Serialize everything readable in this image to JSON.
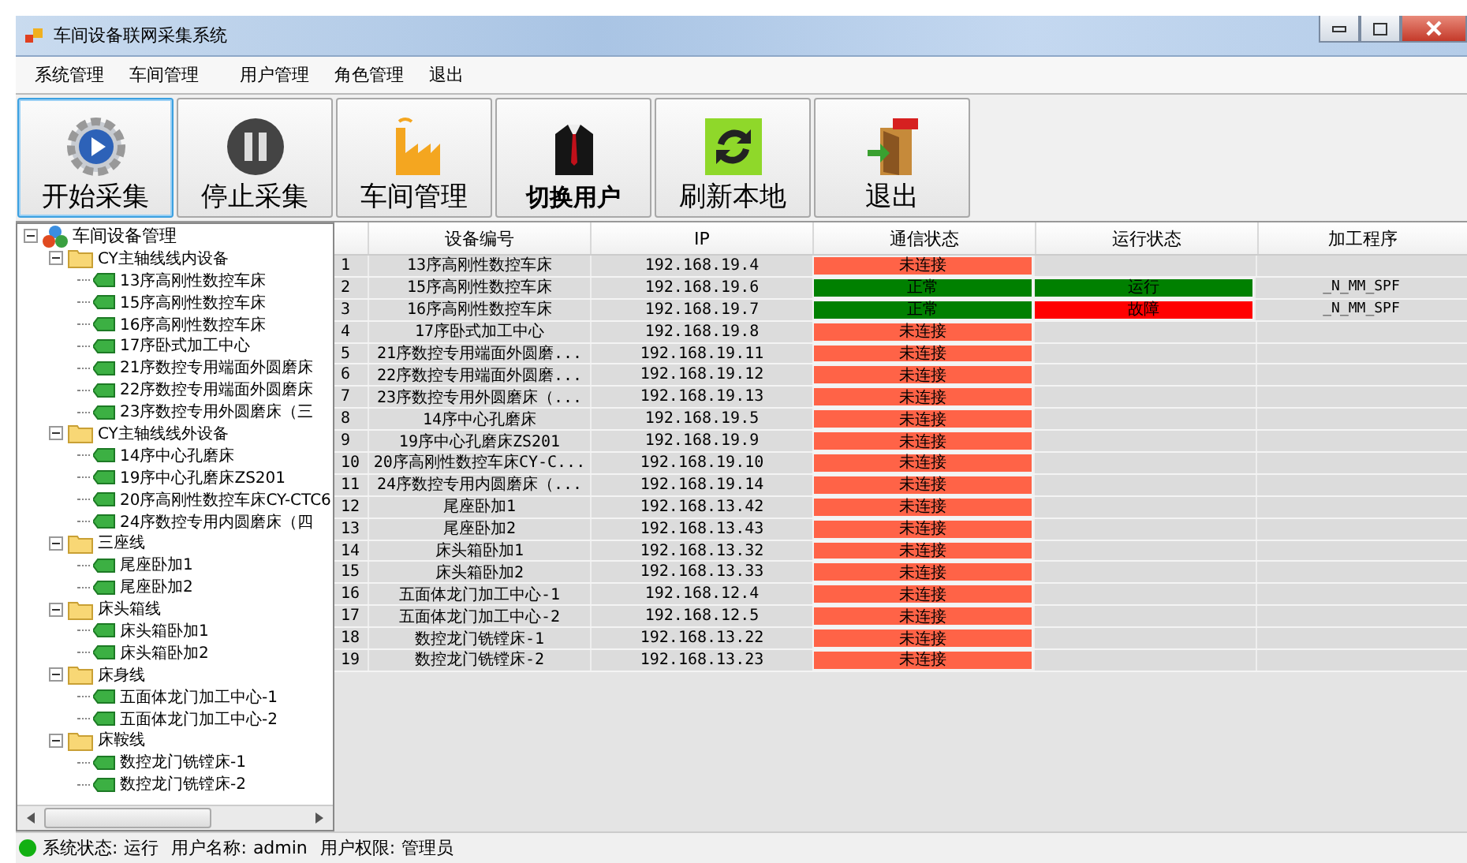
{
  "window": {
    "title": "车间设备联网采集系统"
  },
  "menu": [
    "系统管理",
    "车间管理",
    "用户管理",
    "角色管理",
    "退出"
  ],
  "toolbar": [
    {
      "label": "开始采集",
      "kind": "start",
      "selected": true
    },
    {
      "label": "停止采集",
      "kind": "stop",
      "selected": false
    },
    {
      "label": "车间管理",
      "kind": "factory",
      "selected": false
    },
    {
      "label": "切换用户",
      "kind": "user",
      "selected": false
    },
    {
      "label": "刷新本地",
      "kind": "refresh",
      "selected": false
    },
    {
      "label": "退出",
      "kind": "exit",
      "selected": false
    }
  ],
  "tree": [
    {
      "label": "车间设备管理",
      "kind": "root",
      "expanded": true,
      "children": [
        {
          "label": "CY主轴线线内设备",
          "kind": "folder",
          "expanded": true,
          "children": [
            {
              "label": "13序高刚性数控车床",
              "kind": "device"
            },
            {
              "label": "15序高刚性数控车床",
              "kind": "device"
            },
            {
              "label": "16序高刚性数控车床",
              "kind": "device"
            },
            {
              "label": "17序卧式加工中心",
              "kind": "device"
            },
            {
              "label": "21序数控专用端面外圆磨床",
              "kind": "device"
            },
            {
              "label": "22序数控专用端面外圆磨床",
              "kind": "device"
            },
            {
              "label": "23序数控专用外圆磨床（三",
              "kind": "device"
            }
          ]
        },
        {
          "label": "CY主轴线线外设备",
          "kind": "folder",
          "expanded": true,
          "children": [
            {
              "label": "14序中心孔磨床",
              "kind": "device"
            },
            {
              "label": "19序中心孔磨床ZS201",
              "kind": "device"
            },
            {
              "label": "20序高刚性数控车床CY-CTC6",
              "kind": "device"
            },
            {
              "label": "24序数控专用内圆磨床（四",
              "kind": "device"
            }
          ]
        },
        {
          "label": "三座线",
          "kind": "folder",
          "expanded": true,
          "children": [
            {
              "label": "尾座卧加1",
              "kind": "device"
            },
            {
              "label": "尾座卧加2",
              "kind": "device"
            }
          ]
        },
        {
          "label": "床头箱线",
          "kind": "folder",
          "expanded": true,
          "children": [
            {
              "label": "床头箱卧加1",
              "kind": "device"
            },
            {
              "label": "床头箱卧加2",
              "kind": "device"
            }
          ]
        },
        {
          "label": "床身线",
          "kind": "folder",
          "expanded": true,
          "children": [
            {
              "label": "五面体龙门加工中心-1",
              "kind": "device"
            },
            {
              "label": "五面体龙门加工中心-2",
              "kind": "device"
            }
          ]
        },
        {
          "label": "床鞍线",
          "kind": "folder",
          "expanded": true,
          "children": [
            {
              "label": "数控龙门铣镗床-1",
              "kind": "device"
            },
            {
              "label": "数控龙门铣镗床-2",
              "kind": "device"
            }
          ]
        }
      ]
    }
  ],
  "table": {
    "columns": [
      "设备编号",
      "IP",
      "通信状态",
      "运行状态",
      "加工程序"
    ],
    "rows": [
      {
        "no": "1",
        "device": "13序高刚性数控车床",
        "ip": "192.168.19.4",
        "comm": {
          "text": "未连接",
          "color": "#ff6347"
        }
      },
      {
        "no": "2",
        "device": "15序高刚性数控车床",
        "ip": "192.168.19.6",
        "comm": {
          "text": "正常",
          "color": "#008000"
        },
        "run": {
          "text": "运行",
          "color": "#008000"
        },
        "program": "_N_MM_SPF"
      },
      {
        "no": "3",
        "device": "16序高刚性数控车床",
        "ip": "192.168.19.7",
        "comm": {
          "text": "正常",
          "color": "#008000"
        },
        "run": {
          "text": "故障",
          "color": "#ff0000"
        },
        "program": "_N_MM_SPF"
      },
      {
        "no": "4",
        "device": "17序卧式加工中心",
        "ip": "192.168.19.8",
        "comm": {
          "text": "未连接",
          "color": "#ff6347"
        }
      },
      {
        "no": "5",
        "device": "21序数控专用端面外圆磨...",
        "ip": "192.168.19.11",
        "comm": {
          "text": "未连接",
          "color": "#ff6347"
        }
      },
      {
        "no": "6",
        "device": "22序数控专用端面外圆磨...",
        "ip": "192.168.19.12",
        "comm": {
          "text": "未连接",
          "color": "#ff6347"
        }
      },
      {
        "no": "7",
        "device": "23序数控专用外圆磨床（...",
        "ip": "192.168.19.13",
        "comm": {
          "text": "未连接",
          "color": "#ff6347"
        }
      },
      {
        "no": "8",
        "device": "14序中心孔磨床",
        "ip": "192.168.19.5",
        "comm": {
          "text": "未连接",
          "color": "#ff6347"
        }
      },
      {
        "no": "9",
        "device": "19序中心孔磨床ZS201",
        "ip": "192.168.19.9",
        "comm": {
          "text": "未连接",
          "color": "#ff6347"
        }
      },
      {
        "no": "10",
        "device": "20序高刚性数控车床CY-C...",
        "ip": "192.168.19.10",
        "comm": {
          "text": "未连接",
          "color": "#ff6347"
        }
      },
      {
        "no": "11",
        "device": "24序数控专用内圆磨床（...",
        "ip": "192.168.19.14",
        "comm": {
          "text": "未连接",
          "color": "#ff6347"
        }
      },
      {
        "no": "12",
        "device": "尾座卧加1",
        "ip": "192.168.13.42",
        "comm": {
          "text": "未连接",
          "color": "#ff6347"
        }
      },
      {
        "no": "13",
        "device": "尾座卧加2",
        "ip": "192.168.13.43",
        "comm": {
          "text": "未连接",
          "color": "#ff6347"
        }
      },
      {
        "no": "14",
        "device": "床头箱卧加1",
        "ip": "192.168.13.32",
        "comm": {
          "text": "未连接",
          "color": "#ff6347"
        }
      },
      {
        "no": "15",
        "device": "床头箱卧加2",
        "ip": "192.168.13.33",
        "comm": {
          "text": "未连接",
          "color": "#ff6347"
        }
      },
      {
        "no": "16",
        "device": "五面体龙门加工中心-1",
        "ip": "192.168.12.4",
        "comm": {
          "text": "未连接",
          "color": "#ff6347"
        }
      },
      {
        "no": "17",
        "device": "五面体龙门加工中心-2",
        "ip": "192.168.12.5",
        "comm": {
          "text": "未连接",
          "color": "#ff6347"
        }
      },
      {
        "no": "18",
        "device": "数控龙门铣镗床-1",
        "ip": "192.168.13.22",
        "comm": {
          "text": "未连接",
          "color": "#ff6347"
        }
      },
      {
        "no": "19",
        "device": "数控龙门铣镗床-2",
        "ip": "192.168.13.23",
        "comm": {
          "text": "未连接",
          "color": "#ff6347"
        }
      }
    ]
  },
  "status_bar": [
    {
      "label": "系统状态:",
      "value": "运行"
    },
    {
      "label": "用户名称:",
      "value": "admin"
    },
    {
      "label": "用户权限:",
      "value": "管理员"
    }
  ]
}
